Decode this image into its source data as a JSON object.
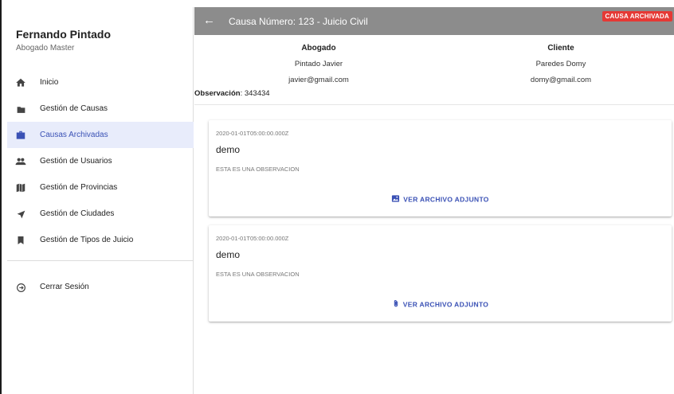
{
  "sidebar": {
    "profile": {
      "name": "Fernando Pintado",
      "role": "Abogado Master"
    },
    "items": [
      {
        "label": "Inicio",
        "icon": "home-icon"
      },
      {
        "label": "Gestión de Causas",
        "icon": "folder-icon"
      },
      {
        "label": "Causas Archivadas",
        "icon": "briefcase-icon",
        "active": true
      },
      {
        "label": "Gestión de Usuarios",
        "icon": "people-icon"
      },
      {
        "label": "Gestión de Provincias",
        "icon": "map-icon"
      },
      {
        "label": "Gestión de Ciudades",
        "icon": "navigation-arrow-icon"
      },
      {
        "label": "Gestión de Tipos de Juicio",
        "icon": "bookmark-icon"
      }
    ],
    "logout": {
      "label": "Cerrar Sesión",
      "icon": "logout-icon"
    }
  },
  "header": {
    "title": "Causa Número: 123 - Juicio Civil",
    "badge": "CAUSA ARCHIVADA"
  },
  "info": {
    "abogado": {
      "title": "Abogado",
      "name": "Pintado Javier",
      "email": "javier@gmail.com"
    },
    "cliente": {
      "title": "Cliente",
      "name": "Paredes Domy",
      "email": "domy@gmail.com"
    },
    "observacion_label": "Observación",
    "observacion_value": ": 343434"
  },
  "cards": [
    {
      "date": "2020-01-01T05:00:00.000Z",
      "title": "demo",
      "observation": "ESTA ES UNA OBSERVACION",
      "button": "VER ARCHIVO ADJUNTO",
      "button_icon": "image-icon"
    },
    {
      "date": "2020-01-01T05:00:00.000Z",
      "title": "demo",
      "observation": "ESTA ES UNA OBSERVACION",
      "button": "VER ARCHIVO ADJUNTO",
      "button_icon": "paperclip-icon"
    }
  ],
  "colors": {
    "accent": "#3a51b5",
    "topbar": "#8c8c8c",
    "badge": "#e53935",
    "active_bg": "#e8ecfb"
  }
}
